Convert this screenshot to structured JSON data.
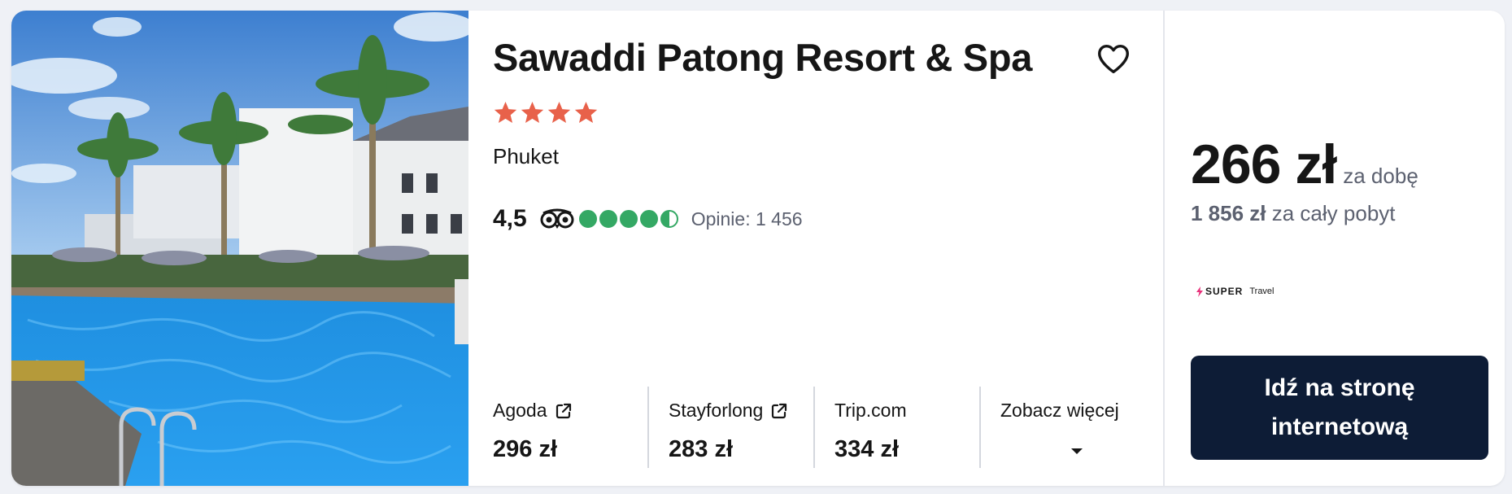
{
  "hotel": {
    "name": "Sawaddi Patong Resort & Spa",
    "star_count": 4,
    "location": "Phuket",
    "photo_icon": "hotel-pool-photo"
  },
  "rating": {
    "score": "4,5",
    "bubbles_value": 4.5,
    "bubbles_max": 5,
    "reviews_text": "Opinie: 1 456",
    "icon": "tripadvisor-owl-icon"
  },
  "offers": [
    {
      "name": "Agoda",
      "price": "296 zł",
      "external": true
    },
    {
      "name": "Stayforlong",
      "price": "283 zł",
      "external": true
    },
    {
      "name": "Trip.com",
      "price": "334 zł",
      "external": false
    }
  ],
  "see_more": {
    "label": "Zobacz więcej",
    "icon": "caret-down-icon"
  },
  "pricing": {
    "price": "266 zł",
    "per_night": "za dobę",
    "total_price": "1 856 zł",
    "total_label": "za cały pobyt"
  },
  "provider": {
    "brand": "SUPER",
    "brand_suffix": "Travel"
  },
  "cta": {
    "label": "Idź na stronę internetową"
  },
  "colors": {
    "star": "#e8614a",
    "bubble": "#34a864",
    "cta_bg": "#0d1c36",
    "muted_text": "#5c6170"
  }
}
